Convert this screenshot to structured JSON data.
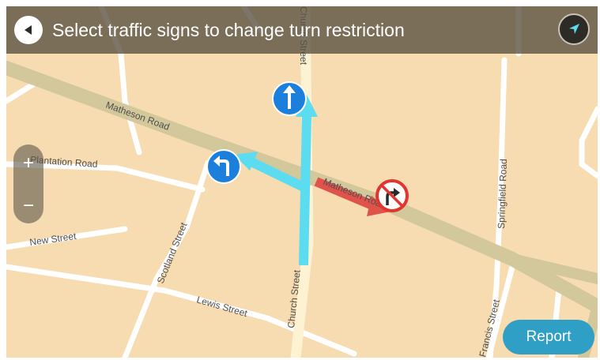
{
  "header": {
    "title": "Select traffic signs to change turn restriction",
    "back_icon": "back-arrow-icon",
    "locate_icon": "location-arrow-icon"
  },
  "map": {
    "streets": {
      "matheson_road_upper": "Matheson Road",
      "matheson_road_lower": "Matheson Road",
      "plantation_road": "Plantation Road",
      "new_street": "New Street",
      "scotland_street": "Scotland Street",
      "lewis_street": "Lewis Street",
      "church_street_lower": "Church Street",
      "church_street_upper": "Church Street",
      "springfield_road": "Springfield Road",
      "francis_street": "Francis Street"
    },
    "signs": {
      "straight": "straight-ahead-arrow-icon",
      "left": "turn-left-arrow-icon",
      "no_right_turn": "no-right-turn-sign-icon"
    },
    "colors": {
      "land": "#f6dcb0",
      "major_road": "#d3c79c",
      "minor_road": "#ffffff",
      "route": "#5bdcf0",
      "restricted": "#e0534a",
      "sign_blue": "#1c7fdc"
    }
  },
  "zoom": {
    "in_label": "+",
    "out_label": "−"
  },
  "footer": {
    "report_label": "Report"
  }
}
